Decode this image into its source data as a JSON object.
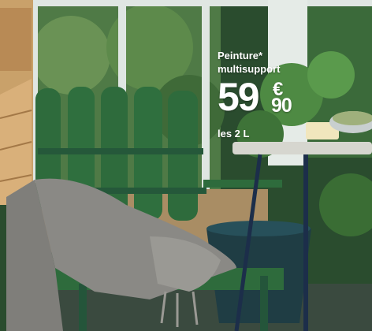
{
  "promo": {
    "product_line1": "Peinture*",
    "product_line2": "multisupport",
    "price_integer": "59",
    "price_currency": "€",
    "price_decimal": "90",
    "volume": "les 2 L"
  },
  "colors": {
    "chair_green": "#2e6b3c",
    "foliage": "#3d6b35",
    "wall_white": "#e8ede9",
    "table_top": "#d6d6cf",
    "pot": "#1f3d44",
    "blanket": "#8a8985"
  }
}
